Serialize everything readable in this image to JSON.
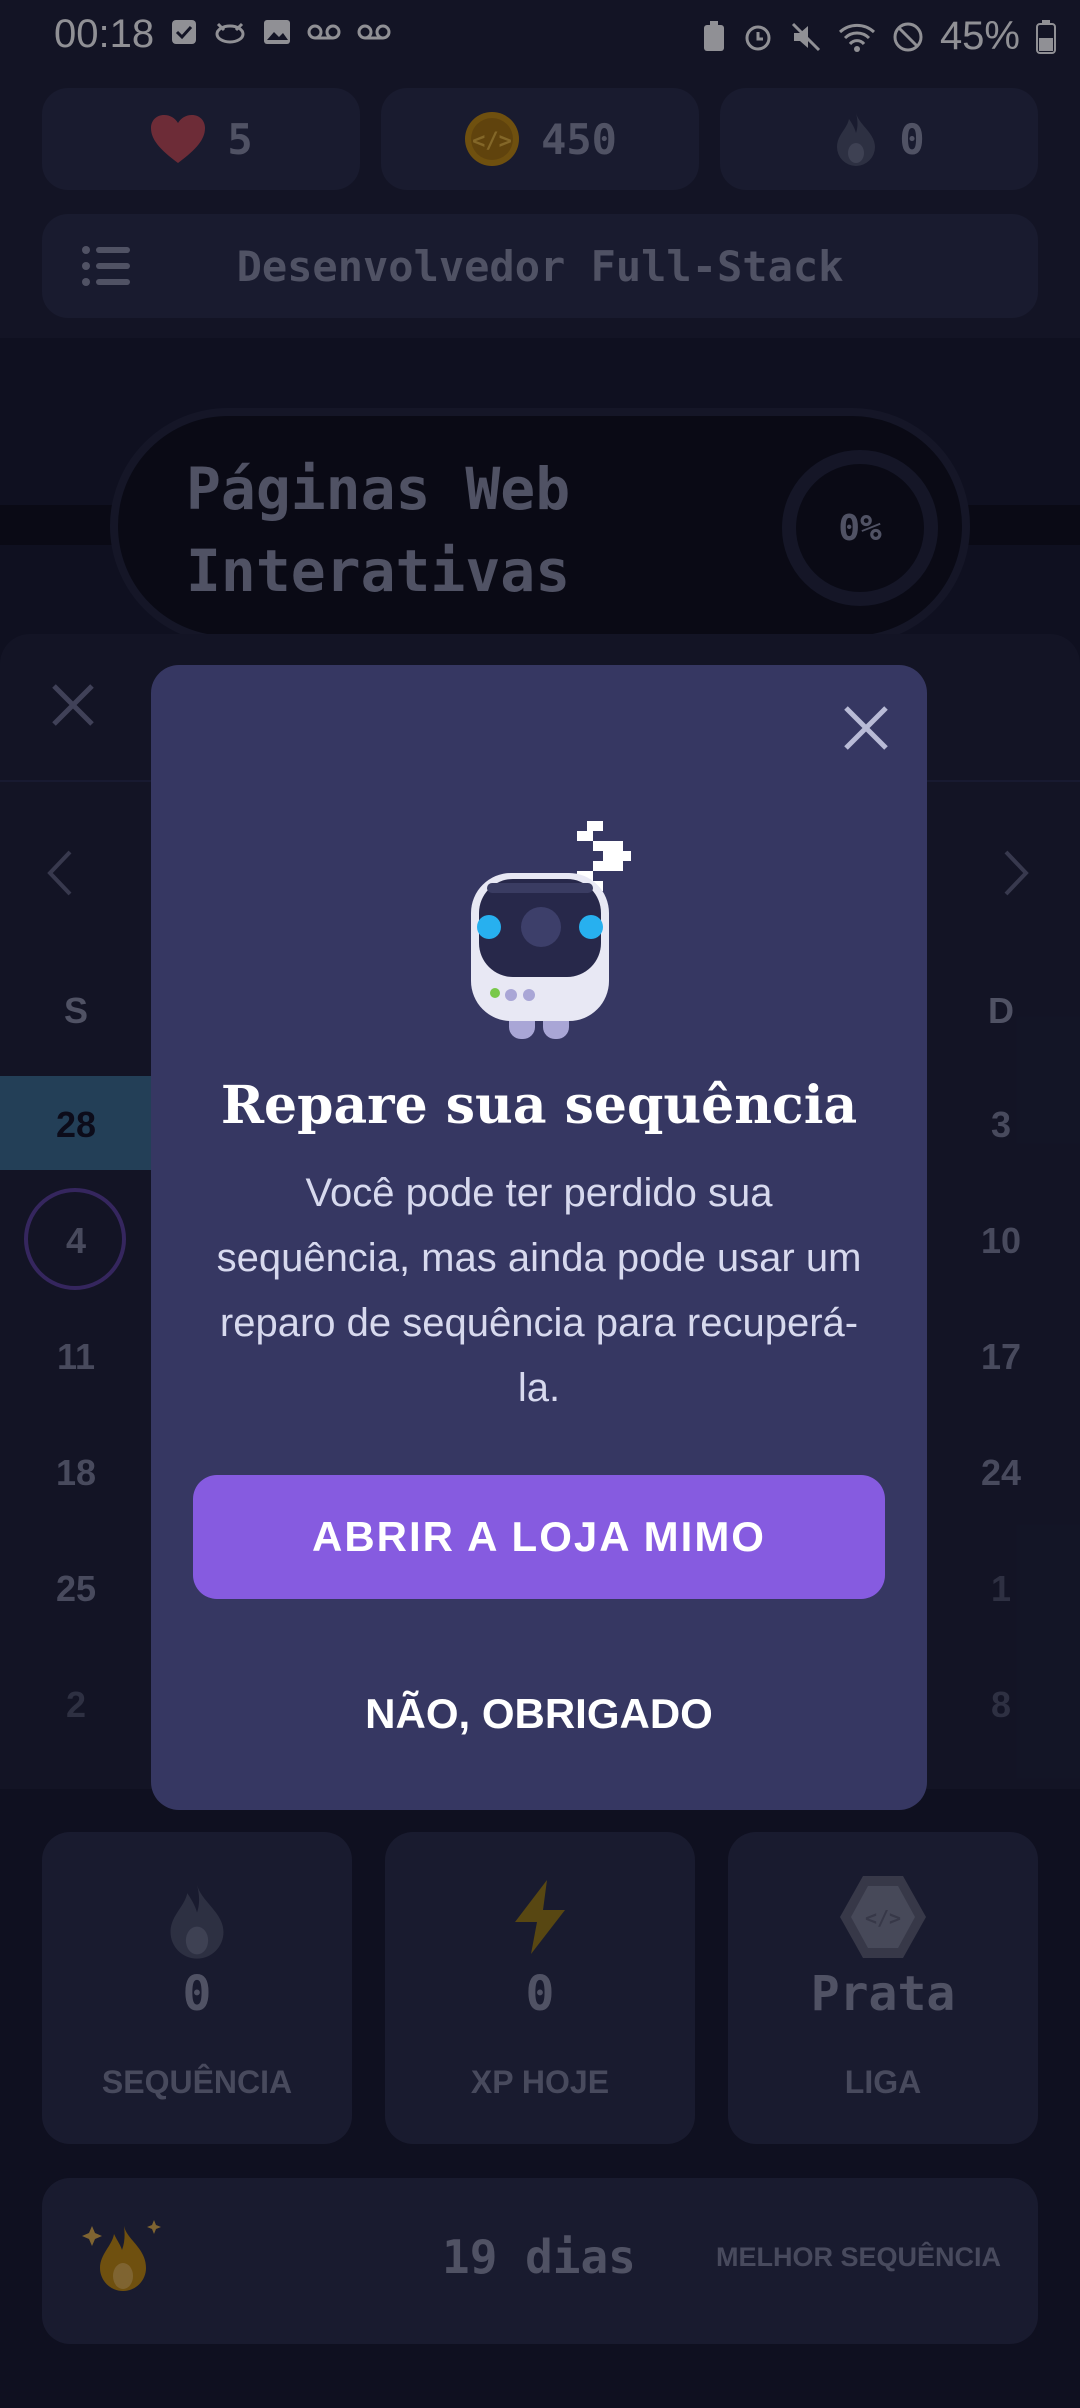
{
  "status_bar": {
    "time": "00:18",
    "battery": "45%"
  },
  "header": {
    "hearts": "5",
    "coins": "450",
    "streak": "0",
    "course_title": "Desenvolvedor Full-Stack"
  },
  "lesson": {
    "title": "Páginas Web Interativas",
    "progress": "0%"
  },
  "calendar": {
    "weekday_first": "S",
    "weekday_last": "D",
    "left_column": [
      "28",
      "4",
      "11",
      "18",
      "25",
      "2"
    ],
    "right_column": [
      "3",
      "10",
      "17",
      "24",
      "1",
      "8"
    ]
  },
  "cards": {
    "streak": {
      "value": "0",
      "label": "SEQUÊNCIA"
    },
    "xp": {
      "value": "0",
      "label": "XP HOJE"
    },
    "league": {
      "value": "Prata",
      "label": "LIGA"
    }
  },
  "best_streak": {
    "value": "19 dias",
    "label": "MELHOR SEQUÊNCIA"
  },
  "modal": {
    "title": "Repare sua sequência",
    "body": "Você pode ter perdido sua sequência, mas ainda pode usar um reparo de sequência para recuperá-la.",
    "primary_button": "ABRIR A LOJA MIMO",
    "secondary_button": "NÃO, OBRIGADO"
  },
  "colors": {
    "accent": "#865be0",
    "modal_bg": "#363762",
    "highlight": "#3a6c8f"
  }
}
